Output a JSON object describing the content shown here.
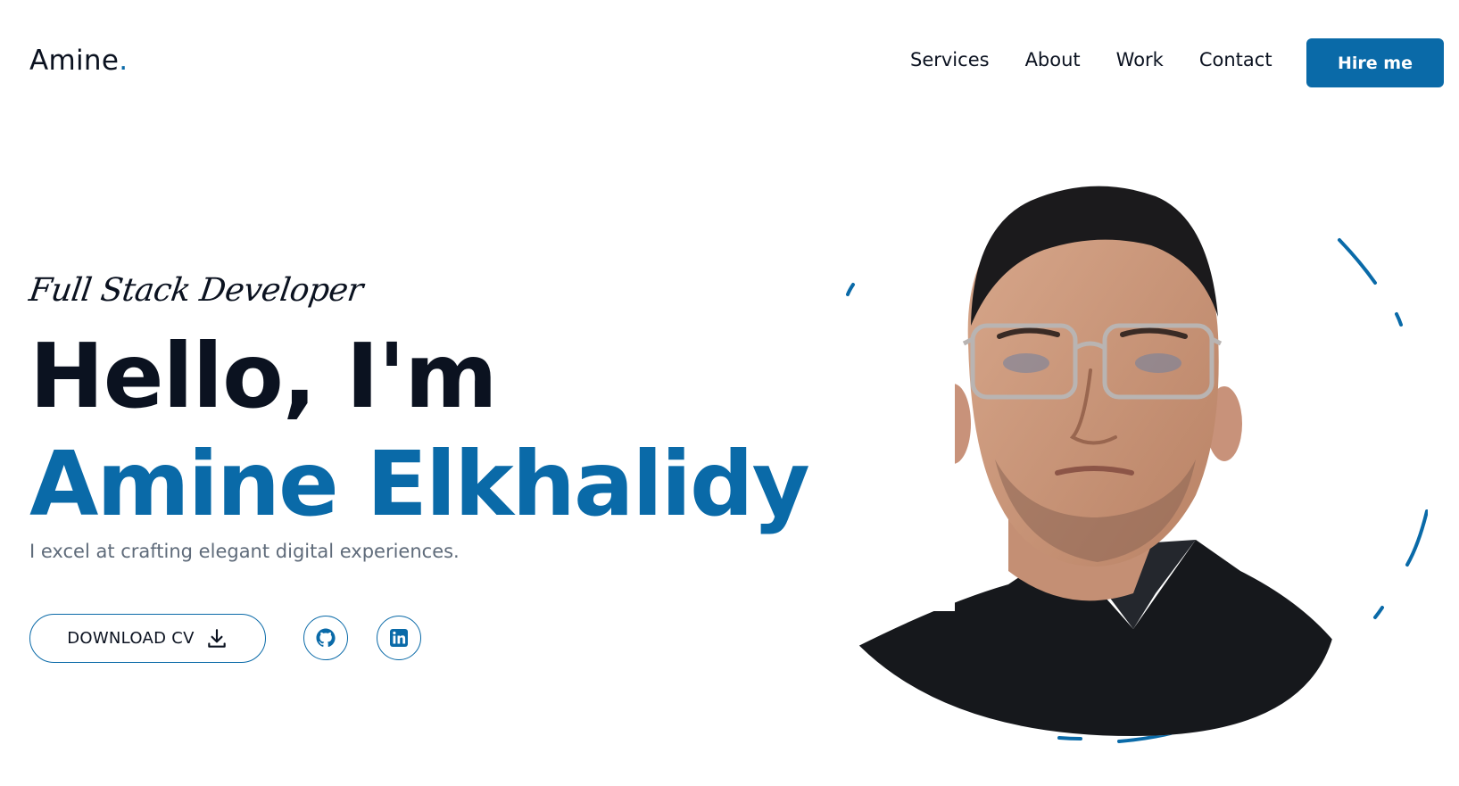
{
  "header": {
    "logo_text": "Amine",
    "logo_dot": ".",
    "nav": [
      "Services",
      "About",
      "Work",
      "Contact"
    ],
    "hire_label": "Hire me"
  },
  "hero": {
    "role": "Full Stack Developer",
    "greeting": "Hello, I'm",
    "name": "Amine Elkhalidy",
    "tagline": "I excel at crafting elegant digital experiences.",
    "cv_label": "DOWNLOAD CV"
  },
  "icons": {
    "download": "download-icon",
    "github": "github-icon",
    "linkedin": "linkedin-icon"
  },
  "colors": {
    "accent": "#0a6aa8",
    "text": "#0b1220",
    "muted": "#5f6b7a"
  }
}
